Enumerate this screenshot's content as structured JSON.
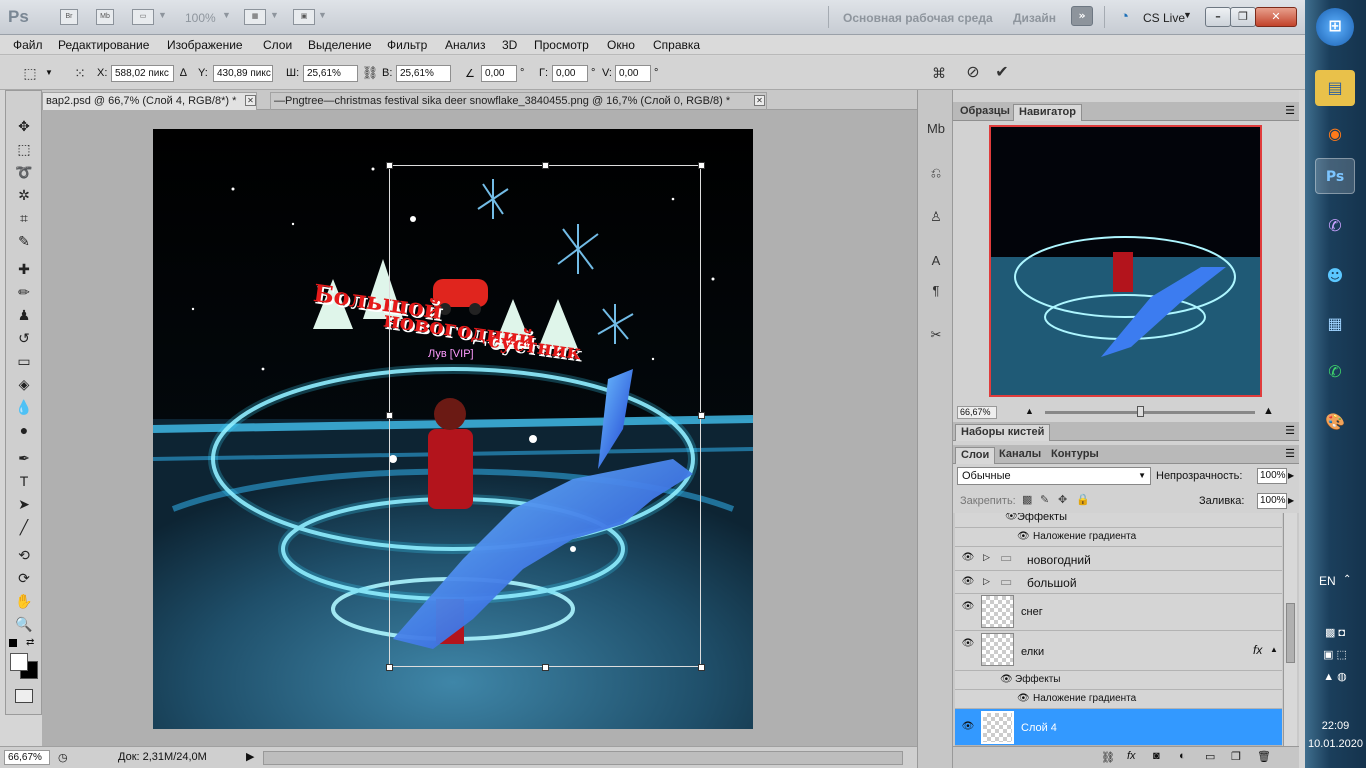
{
  "titlebar": {
    "logo": "Ps",
    "br": "Br",
    "mb": "Mb",
    "zoom": "100%",
    "workspace": "Основная рабочая среда",
    "design": "Дизайн",
    "cslive": "CS Live"
  },
  "menu": [
    "Файл",
    "Редактирование",
    "Изображение",
    "Слои",
    "Выделение",
    "Фильтр",
    "Анализ",
    "3D",
    "Просмотр",
    "Окно",
    "Справка"
  ],
  "options": {
    "x_label": "X:",
    "x_value": "588,02 пикс",
    "y_label": "Y:",
    "y_value": "430,89 пикс",
    "w_label": "Ш:",
    "w_value": "25,61%",
    "h_label": "В:",
    "h_value": "25,61%",
    "angle_value": "0,00",
    "hskew_label": "Г:",
    "hskew_value": "0,00",
    "vskew_label": "V:",
    "vskew_value": "0,00",
    "degree": "°"
  },
  "tabs": [
    {
      "label": "вар2.psd @ 66,7% (Слой 4, RGB/8*) *"
    },
    {
      "label": "—Pngtree—christmas festival sika deer snowflake_3840455.png @ 16,7% (Слой 0, RGB/8) *"
    }
  ],
  "canvas": {
    "title_line1": "Большой",
    "title_line2": "новогодний",
    "title_line3": "сустник",
    "char_label": "Лув [VIP]"
  },
  "status": {
    "zoom": "66,67%",
    "doc": "Док: 2,31М/24,0М"
  },
  "panels": {
    "top_tabs": [
      "Образцы",
      "Навигатор"
    ],
    "nav_zoom": "66,67%",
    "brushes_tab": "Наборы кистей",
    "layer_tabs": [
      "Слои",
      "Каналы",
      "Контуры"
    ],
    "blend_mode": "Обычные",
    "opacity_label": "Непрозрачность:",
    "opacity_value": "100%",
    "lock_label": "Закрепить:",
    "fill_label": "Заливка:",
    "fill_value": "100%"
  },
  "layers": {
    "effects": "Эффекты",
    "gradient_overlay": "Наложение градиента",
    "group1": "новогодний",
    "group2": "большой",
    "snow": "снег",
    "trees": "елки",
    "trees_effects": "Эффекты",
    "trees_overlay": "Наложение градиента",
    "active": "Слой 4",
    "fx": "fx"
  },
  "taskbar": {
    "lang": "EN",
    "time": "22:09",
    "date": "10.01.2020"
  },
  "colors": {
    "selection": "#3aa0f0",
    "bg": "#b0b0b0"
  }
}
